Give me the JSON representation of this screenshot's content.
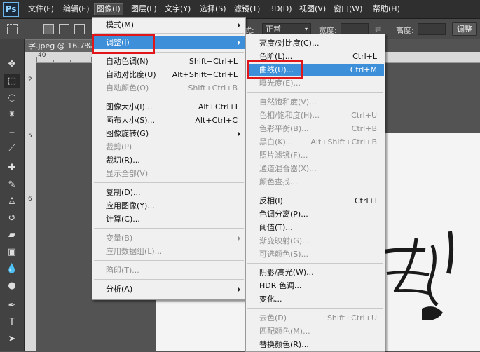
{
  "app": {
    "logo": "Ps"
  },
  "menubar": [
    "文件(F)",
    "编辑(E)",
    "图像(I)",
    "图层(L)",
    "文字(Y)",
    "选择(S)",
    "滤镜(T)",
    "3D(D)",
    "视图(V)",
    "窗口(W)",
    "帮助(H)"
  ],
  "options": {
    "style_label": "式:",
    "style_value": "正常",
    "width_label": "宽度:",
    "height_label": "高度:",
    "adjust_button": "调整"
  },
  "document": {
    "tab_title": "字.jpeg @ 16.7%("
  },
  "rulers": {
    "top_numbers": [
      "40",
      "5"
    ],
    "left_numbers": [
      "2",
      "5",
      "6"
    ]
  },
  "image_menu": {
    "items": [
      {
        "label": "模式(M)",
        "shortcut": "",
        "submenu": true,
        "disabled": false
      },
      {
        "label": "调整(J)",
        "shortcut": "",
        "submenu": true,
        "disabled": false,
        "highlighted": true
      },
      {
        "label": "自动色调(N)",
        "shortcut": "Shift+Ctrl+L",
        "disabled": false
      },
      {
        "label": "自动对比度(U)",
        "shortcut": "Alt+Shift+Ctrl+L",
        "disabled": false
      },
      {
        "label": "自动颜色(O)",
        "shortcut": "Shift+Ctrl+B",
        "disabled": true
      },
      {
        "label": "图像大小(I)...",
        "shortcut": "Alt+Ctrl+I",
        "disabled": false
      },
      {
        "label": "画布大小(S)...",
        "shortcut": "Alt+Ctrl+C",
        "disabled": false
      },
      {
        "label": "图像旋转(G)",
        "shortcut": "",
        "submenu": true,
        "disabled": false
      },
      {
        "label": "裁剪(P)",
        "shortcut": "",
        "disabled": true
      },
      {
        "label": "裁切(R)...",
        "shortcut": "",
        "disabled": false
      },
      {
        "label": "显示全部(V)",
        "shortcut": "",
        "disabled": true
      },
      {
        "label": "复制(D)...",
        "shortcut": "",
        "disabled": false
      },
      {
        "label": "应用图像(Y)...",
        "shortcut": "",
        "disabled": false
      },
      {
        "label": "计算(C)...",
        "shortcut": "",
        "disabled": false
      },
      {
        "label": "变量(B)",
        "shortcut": "",
        "submenu": true,
        "disabled": true
      },
      {
        "label": "应用数据组(L)...",
        "shortcut": "",
        "disabled": true
      },
      {
        "label": "陷印(T)...",
        "shortcut": "",
        "disabled": true
      },
      {
        "label": "分析(A)",
        "shortcut": "",
        "submenu": true,
        "disabled": false
      }
    ]
  },
  "adjust_menu": {
    "items": [
      {
        "label": "亮度/对比度(C)...",
        "shortcut": "",
        "disabled": false
      },
      {
        "label": "色阶(L)...",
        "shortcut": "Ctrl+L",
        "disabled": false
      },
      {
        "label": "曲线(U)...",
        "shortcut": "Ctrl+M",
        "disabled": false,
        "highlighted": true
      },
      {
        "label": "曝光度(E)...",
        "shortcut": "",
        "disabled": true
      },
      {
        "label": "自然饱和度(V)...",
        "shortcut": "",
        "disabled": true
      },
      {
        "label": "色相/饱和度(H)...",
        "shortcut": "Ctrl+U",
        "disabled": true
      },
      {
        "label": "色彩平衡(B)...",
        "shortcut": "Ctrl+B",
        "disabled": true
      },
      {
        "label": "黑白(K)...",
        "shortcut": "Alt+Shift+Ctrl+B",
        "disabled": true
      },
      {
        "label": "照片滤镜(F)...",
        "shortcut": "",
        "disabled": true
      },
      {
        "label": "通道混合器(X)...",
        "shortcut": "",
        "disabled": true
      },
      {
        "label": "颜色查找...",
        "shortcut": "",
        "disabled": true
      },
      {
        "label": "反相(I)",
        "shortcut": "Ctrl+I",
        "disabled": false
      },
      {
        "label": "色调分离(P)...",
        "shortcut": "",
        "disabled": false
      },
      {
        "label": "阈值(T)...",
        "shortcut": "",
        "disabled": false
      },
      {
        "label": "渐变映射(G)...",
        "shortcut": "",
        "disabled": true
      },
      {
        "label": "可选颜色(S)...",
        "shortcut": "",
        "disabled": true
      },
      {
        "label": "阴影/高光(W)...",
        "shortcut": "",
        "disabled": false
      },
      {
        "label": "HDR 色调...",
        "shortcut": "",
        "disabled": false
      },
      {
        "label": "变化...",
        "shortcut": "",
        "disabled": false
      },
      {
        "label": "去色(D)",
        "shortcut": "Shift+Ctrl+U",
        "disabled": true
      },
      {
        "label": "匹配颜色(M)...",
        "shortcut": "",
        "disabled": true
      },
      {
        "label": "替换颜色(R)...",
        "shortcut": "",
        "disabled": false
      }
    ]
  },
  "colors": {
    "highlight": "#3e8fd9",
    "annotation_red": "#e0161a",
    "menubar": "#2f2f2f"
  }
}
